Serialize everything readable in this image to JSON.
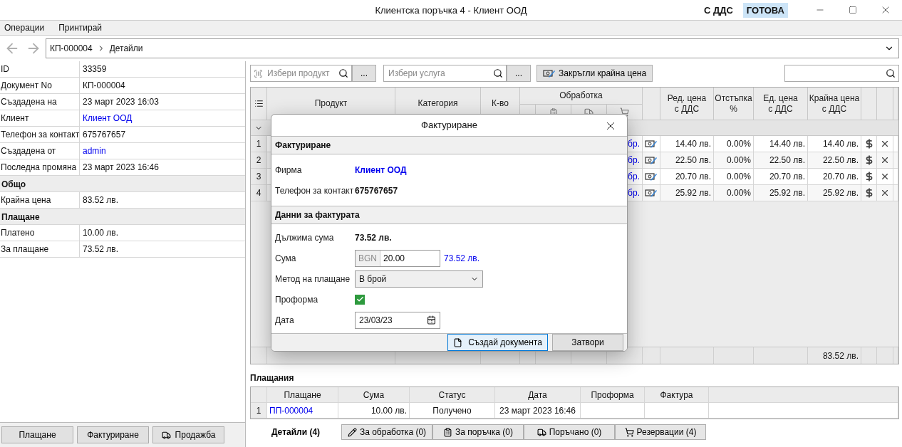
{
  "window": {
    "title": "Клиентска поръчка 4 - Клиент ООД",
    "vat_label": "С ДДС",
    "status": "ГОТОВА"
  },
  "menu": [
    "Операции",
    "Принтирай"
  ],
  "breadcrumb": [
    "КП-000004",
    "Детайли"
  ],
  "properties": [
    {
      "kind": "field",
      "label": "ID",
      "value": "33359",
      "link": false
    },
    {
      "kind": "field",
      "label": "Документ No",
      "value": "КП-000004",
      "link": false
    },
    {
      "kind": "field",
      "label": "Създадена на",
      "value": "23 март 2023 16:03",
      "link": false
    },
    {
      "kind": "field",
      "label": "Клиент",
      "value": "Клиент ООД",
      "link": true
    },
    {
      "kind": "field",
      "label": "Телефон за контакт",
      "value": "675767657",
      "link": false
    },
    {
      "kind": "field",
      "label": "Създадена от",
      "value": "admin",
      "link": true
    },
    {
      "kind": "field",
      "label": "Последна промяна",
      "value": "23 март 2023 16:46",
      "link": false
    },
    {
      "kind": "section",
      "label": "Общо"
    },
    {
      "kind": "field",
      "label": "Крайна цена",
      "value": "83.52 лв.",
      "link": false
    },
    {
      "kind": "section",
      "label": "Плащане"
    },
    {
      "kind": "field",
      "label": "Платено",
      "value": "10.00 лв.",
      "link": false
    },
    {
      "kind": "field",
      "label": "За плащане",
      "value": "73.52 лв.",
      "link": false
    }
  ],
  "actions": [
    {
      "label": "Плащане",
      "kind": "plain"
    },
    {
      "label": "Фактуриране",
      "kind": "plain"
    },
    {
      "label": "Продажба",
      "kind": "sale"
    }
  ],
  "toolbar": {
    "product_search": {
      "placeholder": "Избери продукт"
    },
    "product_more": "...",
    "service_search": {
      "placeholder": "Избери услуга"
    },
    "service_more": "...",
    "round_button": "Закръгли крайна цена"
  },
  "grid": {
    "header": {
      "product": "Продукт",
      "category": "Категория",
      "quantity": "К-во",
      "processing": "Обработка",
      "row_price": "Ред. цена\nс ДДС",
      "discount": "Отстъпка\n%",
      "unit_price": "Ед. цена\nс ДДС",
      "final_price": "Крайна цена\nс ДДС"
    },
    "rows": [
      {
        "number": "1",
        "unit": "бр.",
        "row_price": "14.40 лв.",
        "discount": "0.00%",
        "unit_price": "14.40 лв.",
        "final_price": "14.40 лв."
      },
      {
        "number": "2",
        "unit": "бр.",
        "row_price": "22.50 лв.",
        "discount": "0.00%",
        "unit_price": "22.50 лв.",
        "final_price": "22.50 лв."
      },
      {
        "number": "3",
        "unit": "бр.",
        "row_price": "20.70 лв.",
        "discount": "0.00%",
        "unit_price": "20.70 лв.",
        "final_price": "20.70 лв."
      },
      {
        "number": "4",
        "unit": "бр.",
        "row_price": "25.92 лв.",
        "discount": "0.00%",
        "unit_price": "25.92 лв.",
        "final_price": "25.92 лв."
      }
    ],
    "total": "83.52 лв."
  },
  "payments": {
    "title": "Плащания",
    "columns": [
      "Плащане",
      "Сума",
      "Статус",
      "Дата",
      "Проформа",
      "Фактура"
    ],
    "rows": [
      {
        "number": "1",
        "cells": [
          "ПП-000004",
          "10.00 лв.",
          "Получено",
          "23 март 2023 16:46",
          "",
          ""
        ]
      }
    ]
  },
  "tabs": [
    {
      "label": "Детайли (4)",
      "selected": true,
      "kind": "none"
    },
    {
      "label": "За обработка (0)",
      "selected": false,
      "kind": "pencil"
    },
    {
      "label": "За поръчка (0)",
      "selected": false,
      "kind": "clipboard"
    },
    {
      "label": "Поръчано (0)",
      "selected": false,
      "kind": "truck"
    },
    {
      "label": "Резервации (4)",
      "selected": false,
      "kind": "cart"
    }
  ],
  "dialog": {
    "title": "Фактуриране",
    "sections": [
      {
        "title": "Фактуриране",
        "fields": [
          {
            "kind": "link",
            "label": "Фирма",
            "value": "Клиент ООД"
          },
          {
            "kind": "bold",
            "label": "Телефон за контакт",
            "value": "675767657"
          }
        ]
      },
      {
        "title": "Данни за фактурата",
        "fields": [
          {
            "kind": "bold",
            "label": "Дължима сума",
            "value": "73.52 лв."
          },
          {
            "kind": "amount",
            "label": "Сума",
            "currency": "BGN",
            "value": "20.00",
            "hint": "73.52 лв."
          },
          {
            "kind": "select",
            "label": "Метод на плащане",
            "value": "В брой"
          },
          {
            "kind": "checkbox",
            "label": "Проформа",
            "checked": true
          },
          {
            "kind": "date",
            "label": "Дата",
            "value": "23/03/23"
          }
        ]
      }
    ],
    "buttons": [
      {
        "label": "Създай документа",
        "default": true
      },
      {
        "label": "Затвори",
        "default": false
      }
    ]
  }
}
